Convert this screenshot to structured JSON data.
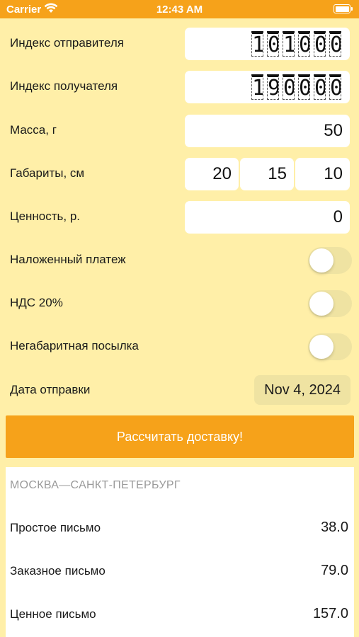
{
  "status_bar": {
    "carrier": "Carrier",
    "time": "12:43 AM"
  },
  "form": {
    "sender_index": {
      "label": "Индекс отправителя",
      "digits": [
        "1",
        "0",
        "1",
        "0",
        "0",
        "0"
      ]
    },
    "recipient_index": {
      "label": "Индекс получателя",
      "digits": [
        "1",
        "9",
        "0",
        "0",
        "0",
        "0"
      ]
    },
    "mass": {
      "label": "Масса, г",
      "value": "50"
    },
    "dimensions": {
      "label": "Габариты, см",
      "values": [
        "20",
        "15",
        "10"
      ]
    },
    "value": {
      "label": "Ценность, р.",
      "value": "0"
    },
    "cash_on_delivery": {
      "label": "Наложенный платеж",
      "on": false
    },
    "vat": {
      "label": "НДС 20%",
      "on": false
    },
    "oversized": {
      "label": "Негабаритная посылка",
      "on": false
    },
    "send_date": {
      "label": "Дата отправки",
      "value": "Nov 4, 2024"
    }
  },
  "calculate_button": "Рассчитать доставку!",
  "results": {
    "route": "МОСКВА—САНКТ-ПЕТЕРБУРГ",
    "rows": [
      {
        "name": "Простое письмо",
        "price": "38.0"
      },
      {
        "name": "Заказное письмо",
        "price": "79.0"
      },
      {
        "name": "Ценное письмо",
        "price": "157.0"
      }
    ]
  },
  "colors": {
    "background": "#FFEFA8",
    "accent": "#F6A21A",
    "field": "#FFFFFF",
    "toggle_off": "#EFE3A2"
  }
}
